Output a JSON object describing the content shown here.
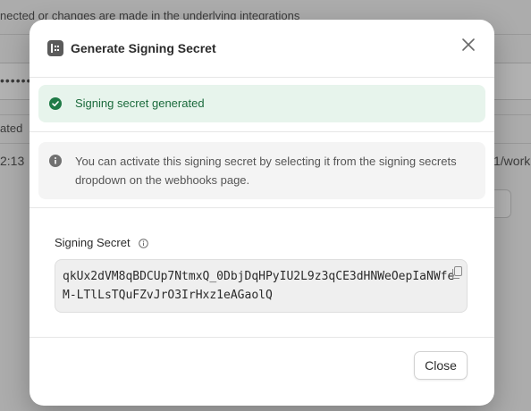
{
  "background": {
    "top_text": "nected or changes are made in the underlying integrations",
    "masked_value": "•••••••",
    "column_fragment": "ated",
    "time_fragment": "2:13",
    "url_fragment": "1/work"
  },
  "modal": {
    "title": "Generate Signing Secret",
    "success_message": "Signing secret generated",
    "info_message": "You can activate this signing secret by selecting it from the signing secrets dropdown on the webhooks page.",
    "field_label": "Signing Secret",
    "secret_value": "qkUx2dVM8qBDCUp7NtmxQ_0DbjDqHPyIU2L9z3qCE3dHNWeOepIaNWfeM-LTlLsTQuFZvJrO3IrHxz1eAGaolQ",
    "close_button": "Close"
  },
  "colors": {
    "success_bg": "#e7f4ec",
    "success_text": "#1b6a3c",
    "info_bg": "#f4f4f4"
  },
  "icons": [
    "webhook-icon",
    "close-icon",
    "check-circle-icon",
    "info-circle-icon",
    "info-icon",
    "copy-icon"
  ]
}
